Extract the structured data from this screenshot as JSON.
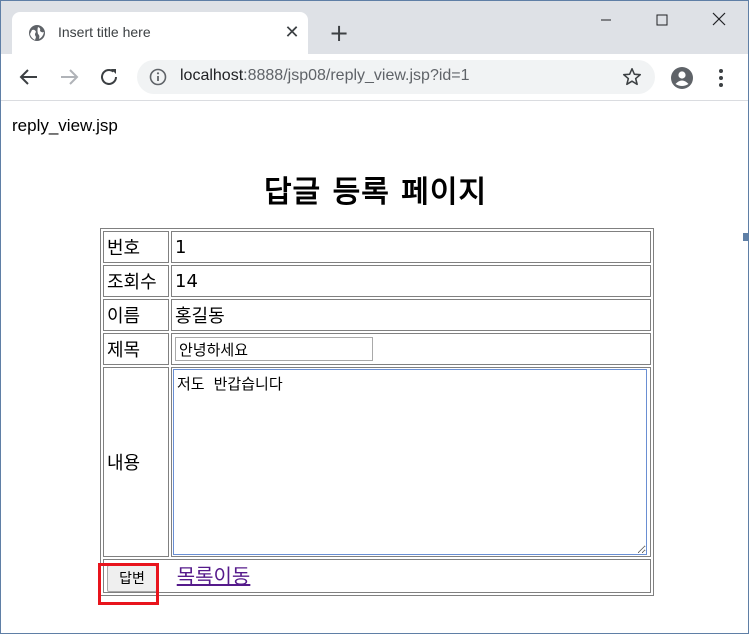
{
  "browser": {
    "tab_title": "Insert title here",
    "url_host": "localhost",
    "url_rest": ":8888/jsp08/reply_view.jsp?id=1",
    "icons": {
      "favicon": "globe-icon",
      "close": "close-icon",
      "new_tab": "plus-icon",
      "back": "arrow-left-icon",
      "forward": "arrow-right-icon",
      "reload": "reload-icon",
      "info": "info-icon",
      "bookmark": "star-icon",
      "profile": "account-icon",
      "menu": "kebab-menu-icon",
      "minimize": "minimize-icon",
      "maximize": "maximize-icon",
      "close_window": "close-window-icon"
    }
  },
  "page": {
    "filename": "reply_view.jsp",
    "heading": "답글 등록 페이지",
    "rows": {
      "number_label": "번호",
      "number_value": "1",
      "views_label": "조회수",
      "views_value": "14",
      "name_label": "이름",
      "name_value": "홍길동",
      "title_label": "제목",
      "title_value": "안녕하세요",
      "content_label": "내용",
      "content_value": "저도 반갑습니다"
    },
    "reply_button": "답변",
    "list_link": "목록이동",
    "colors": {
      "highlight": "#e8141c",
      "link": "#551a8b"
    }
  }
}
